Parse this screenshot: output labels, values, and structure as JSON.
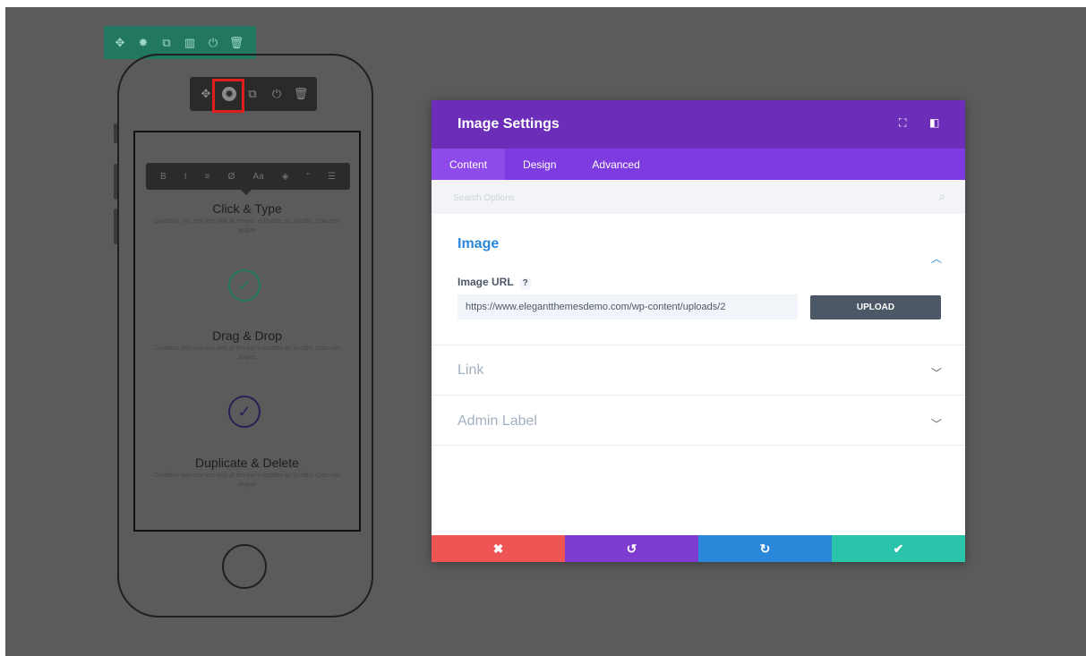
{
  "phone_preview": {
    "row_toolbar": {
      "icons": [
        "move-icon",
        "gear-icon",
        "duplicate-icon",
        "columns-icon",
        "power-icon",
        "trash-icon"
      ]
    },
    "module_toolbar": {
      "icons": [
        "move-icon",
        "gear-icon",
        "duplicate-icon",
        "power-icon",
        "trash-icon"
      ],
      "active": "gear-icon"
    },
    "text_toolbar": {
      "buttons": [
        "B",
        "I",
        "≡",
        "Ø",
        "Aa",
        "◈",
        "”",
        "☰"
      ]
    },
    "features": [
      {
        "title": "Click & Type",
        "desc": "Curabitur non nisi nec velit at tempor vulputate ac ut odio. Cras nec augue",
        "check_color": "#21775f"
      },
      {
        "title": "Drag & Drop",
        "desc": "Curabitur non nisi nec velit at tempor vulputate ac ut odio. Cras nec augue",
        "check_color": ""
      },
      {
        "title": "Duplicate & Delete",
        "desc": "Curabitur non nisi nec velit at tempor vulputate ac ut odio. Cras nec augue",
        "check_color": "#2a1f55"
      }
    ]
  },
  "modal": {
    "title": "Image Settings",
    "header_icons": [
      "expand-icon",
      "sidebar-icon"
    ],
    "tabs": [
      {
        "label": "Content",
        "active": true
      },
      {
        "label": "Design",
        "active": false
      },
      {
        "label": "Advanced",
        "active": false
      }
    ],
    "search": {
      "placeholder": "Search Options",
      "value": ""
    },
    "sections": [
      {
        "title": "Image",
        "expanded": true,
        "field": {
          "label": "Image URL",
          "help": "?",
          "value": "https://www.elegantthemesdemo.com/wp-content/uploads/2",
          "button": "UPLOAD"
        }
      },
      {
        "title": "Link",
        "expanded": false
      },
      {
        "title": "Admin Label",
        "expanded": false
      }
    ],
    "footer": {
      "buttons": [
        {
          "icon": "close-icon",
          "glyph": "✖",
          "color": "#ef5555"
        },
        {
          "icon": "undo-icon",
          "glyph": "↺",
          "color": "#7e3bd0"
        },
        {
          "icon": "redo-icon",
          "glyph": "↻",
          "color": "#2b87da"
        },
        {
          "icon": "save-check-icon",
          "glyph": "✔",
          "color": "#29c4a9"
        }
      ]
    }
  },
  "colors": {
    "background": "#5b5b5b",
    "header_purple": "#6c2eb9",
    "tabs_purple": "#7d3be0",
    "accent_blue": "#2b87da",
    "highlight_red": "#e01e1e",
    "row_green": "#21775f"
  }
}
